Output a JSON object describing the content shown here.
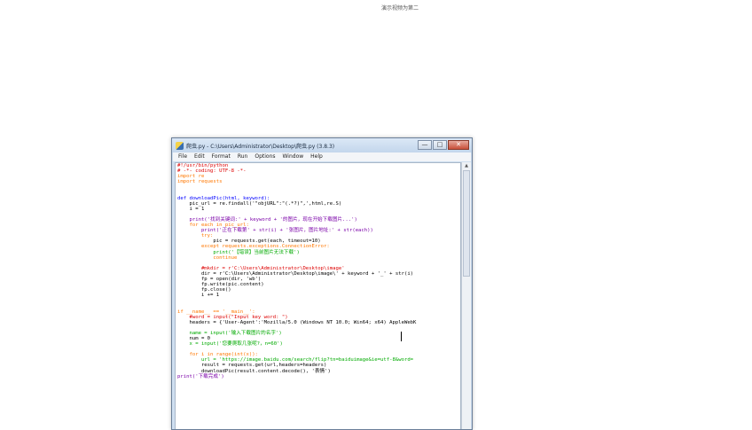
{
  "top_caption": "演示视频为第二",
  "window": {
    "title": "爬虫.py - C:\\Users\\Administrator\\Desktop\\爬虫.py (3.8.3)",
    "minimize_label": "—",
    "maximize_label": "□",
    "close_label": "✕"
  },
  "menu": [
    "File",
    "Edit",
    "Format",
    "Run",
    "Options",
    "Window",
    "Help"
  ],
  "scroll_up_label": "▲",
  "code_lines": [
    {
      "text": "#!/usr/bin/python",
      "color": "#dd0000"
    },
    {
      "text": "# -*- coding: UTF-8 -*-",
      "color": "#dd0000"
    },
    {
      "text": "import re",
      "color": "#ff7700"
    },
    {
      "text": "import requests",
      "color": "#ff7700"
    },
    {
      "text": "",
      "color": "#000000"
    },
    {
      "text": "",
      "color": "#000000"
    },
    {
      "text": "def downloadPic(html, keyword):",
      "color": "#0000ff"
    },
    {
      "text": "    pic_url = re.findall('\"objURL\":\"(.*?)\",',html,re.S)",
      "color": "#000000"
    },
    {
      "text": "    i = 1",
      "color": "#000000"
    },
    {
      "text": "",
      "color": "#000000"
    },
    {
      "text": "    print('找到关键词:' + keyword + '的图片，现在开始下载图片...')",
      "color": "#7a00a8"
    },
    {
      "text": "    for each in pic_url:",
      "color": "#ff7700"
    },
    {
      "text": "        print('正在下载第' + str(i) + '张图片，图片地址:' + str(each))",
      "color": "#7a00a8"
    },
    {
      "text": "        try:",
      "color": "#ff7700"
    },
    {
      "text": "            pic = requests.get(each, timeout=10)",
      "color": "#000000"
    },
    {
      "text": "        except requests.exceptions.ConnectionError:",
      "color": "#ff7700"
    },
    {
      "text": "            print('【错误】当前图片无法下载')",
      "color": "#00aa00"
    },
    {
      "text": "            continue",
      "color": "#ff7700"
    },
    {
      "text": "",
      "color": "#000000"
    },
    {
      "text": "        #mkdir = r'C:\\Users\\Administrator\\Desktop\\image'",
      "color": "#dd0000"
    },
    {
      "text": "        dir = r'C:\\Users\\Administrator\\Desktop\\image\\' + keyword + '_' + str(i)",
      "color": "#000000"
    },
    {
      "text": "        fp = open(dir, 'wb')",
      "color": "#000000"
    },
    {
      "text": "        fp.write(pic.content)",
      "color": "#000000"
    },
    {
      "text": "        fp.close()",
      "color": "#000000"
    },
    {
      "text": "        i += 1",
      "color": "#000000"
    },
    {
      "text": "",
      "color": "#000000"
    },
    {
      "text": "",
      "color": "#000000"
    },
    {
      "text": "if __name__ == '__main__':",
      "color": "#ff7700"
    },
    {
      "text": "    #word = input(\"Input key word: \")",
      "color": "#dd0000"
    },
    {
      "text": "    headers = {'User-Agent':'Mozilla/5.0 (Windows NT 10.0; Win64; x64) AppleWebK",
      "color": "#000000"
    },
    {
      "text": "",
      "color": "#000000"
    },
    {
      "text": "    name = input('输入下载图片的名字')",
      "color": "#00aa00"
    },
    {
      "text": "    num = 0",
      "color": "#000000"
    },
    {
      "text": "    x = input('您要爬取几张呢?，n=60')",
      "color": "#00aa00"
    },
    {
      "text": "",
      "color": "#000000"
    },
    {
      "text": "    for i in range(int(x)):",
      "color": "#ff7700"
    },
    {
      "text": "        url = 'https://image.baidu.com/search/flip?tn=baiduimage&ie=utf-8&word=",
      "color": "#00aa00"
    },
    {
      "text": "        result = requests.get(url,headers=headers)",
      "color": "#000000"
    },
    {
      "text": "        downloadPic(result.content.decode(), '表情')",
      "color": "#000000"
    },
    {
      "text": "print('下载完成')",
      "color": "#7a00a8"
    }
  ]
}
